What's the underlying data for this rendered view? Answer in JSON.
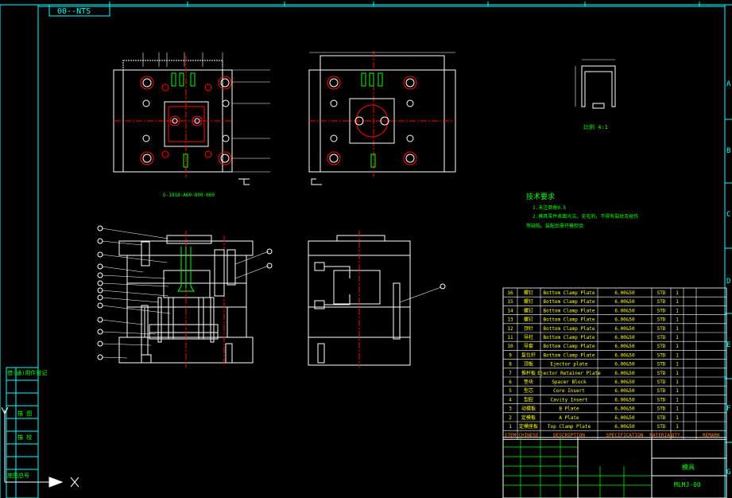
{
  "title_tab": "00--NTS",
  "drawing_id": "G-1818-A60-800-060",
  "detail_label": "比例 4:1",
  "tech_req": {
    "heading": "技术要求",
    "line1": "1.未注倒角0.5",
    "line2": "2.模具零件表面光洁，无毛刺，不得有裂纹及碰伤",
    "line3": "等缺陷。装配后需开模检验"
  },
  "bom": {
    "rows": [
      {
        "no": "16",
        "cn": "螺钉",
        "desc": "Bottom Clamp Plate",
        "spec": "6.00&50",
        "mat": "STD",
        "qty": "1"
      },
      {
        "no": "15",
        "cn": "螺钉",
        "desc": "Bottom Clamp Plate",
        "spec": "6.00&50",
        "mat": "STD",
        "qty": "1"
      },
      {
        "no": "14",
        "cn": "螺钉",
        "desc": "Bottom Clamp Plate",
        "spec": "6.00&50",
        "mat": "STD",
        "qty": "1"
      },
      {
        "no": "13",
        "cn": "螺钉",
        "desc": "Bottom Clamp Plate",
        "spec": "6.00&50",
        "mat": "STD",
        "qty": "1"
      },
      {
        "no": "12",
        "cn": "顶针",
        "desc": "Bottom Clamp Plate",
        "spec": "6.00&50",
        "mat": "STD",
        "qty": "1"
      },
      {
        "no": "11",
        "cn": "导柱",
        "desc": "Bottom Clamp Plate",
        "spec": "6.00&50",
        "mat": "STD",
        "qty": "1"
      },
      {
        "no": "10",
        "cn": "导套",
        "desc": "Bottom Clamp Plate",
        "spec": "6.00&50",
        "mat": "STD",
        "qty": "1"
      },
      {
        "no": "9",
        "cn": "复位杆",
        "desc": "Bottom Clamp Plate",
        "spec": "6.00&50",
        "mat": "STD",
        "qty": "1"
      },
      {
        "no": "8",
        "cn": "顶板",
        "desc": "Ejector plate",
        "spec": "6.00&50",
        "mat": "STD",
        "qty": "1"
      },
      {
        "no": "7",
        "cn": "推杆板",
        "desc": "Ejector Retainer Plate",
        "spec": "6.00&50",
        "mat": "STD",
        "qty": "1"
      },
      {
        "no": "6",
        "cn": "垫块",
        "desc": "Spacer Block",
        "spec": "6.00&50",
        "mat": "STD",
        "qty": "1"
      },
      {
        "no": "5",
        "cn": "型芯",
        "desc": "Core Insert",
        "spec": "6.00&50",
        "mat": "STD",
        "qty": "1"
      },
      {
        "no": "4",
        "cn": "型腔",
        "desc": "Cavity Insert",
        "spec": "6.00&50",
        "mat": "STD",
        "qty": "1"
      },
      {
        "no": "3",
        "cn": "动模板",
        "desc": "B Plate",
        "spec": "6.00&50",
        "mat": "STD",
        "qty": "1"
      },
      {
        "no": "2",
        "cn": "定模板",
        "desc": "A Plate",
        "spec": "6.00&50",
        "mat": "STD",
        "qty": "1"
      },
      {
        "no": "1",
        "cn": "定模座板",
        "desc": "Top Clamp Plate",
        "spec": "6.00&50",
        "mat": "STD",
        "qty": "1"
      }
    ],
    "header": {
      "item": "ITEM",
      "chinese": "CHINESE",
      "description": "DESCRIPTION",
      "specification": "SPECIFICATION",
      "material": "MATERIAL",
      "qty": "QTY.",
      "remark": "REMARK"
    }
  },
  "title_block": {
    "name": "模具",
    "number": "MLMJ-00"
  },
  "left_sidebar": {
    "label1": "借(通)用件登记",
    "label2": "描 图",
    "label3": "描 校",
    "label4": "底图总号"
  },
  "border_letters": [
    "A",
    "B",
    "C",
    "D",
    "E",
    "F",
    "G"
  ],
  "colors": {
    "background": "#000000",
    "border": "#00ffff",
    "lines": "#ffffff",
    "centerline": "#ff0000",
    "accent": "#00ff00",
    "bom_text": "#ffff00",
    "header_text": "#ff8000"
  }
}
